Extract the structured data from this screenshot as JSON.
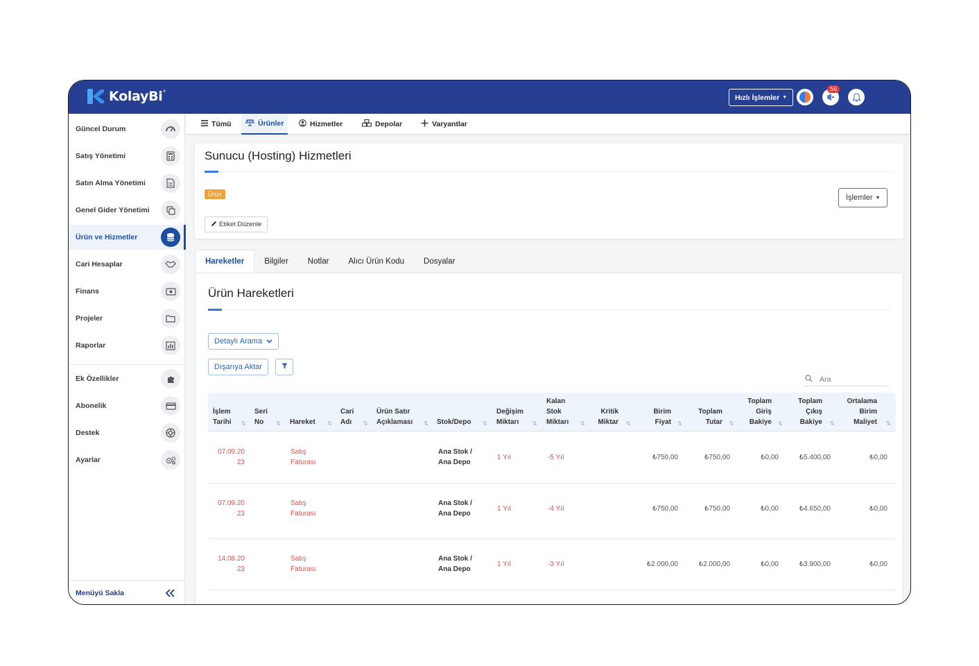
{
  "app": {
    "logo_text": "KolayBi",
    "logo_mark": "°",
    "quick_actions_label": "Hızlı İşlemler",
    "notification_count": "56",
    "colors": {
      "header": "#263f92",
      "accent": "#1d4f9c",
      "tag": "#f0a23b",
      "danger": "#d9534f"
    }
  },
  "sidebar": {
    "items": [
      {
        "label": "Güncel Durum",
        "icon": "dashboard-icon"
      },
      {
        "label": "Satış Yönetimi",
        "icon": "calculator-icon"
      },
      {
        "label": "Satın Alma Yönetimi",
        "icon": "document-icon"
      },
      {
        "label": "Genel Gider Yönetimi",
        "icon": "copy-icon"
      },
      {
        "label": "Ürün ve Hizmetler",
        "icon": "database-icon",
        "active": true
      },
      {
        "label": "Cari Hesaplar",
        "icon": "handshake-icon"
      },
      {
        "label": "Finans",
        "icon": "money-icon"
      },
      {
        "label": "Projeler",
        "icon": "folder-icon"
      },
      {
        "label": "Raporlar",
        "icon": "bar-chart-icon"
      },
      {
        "label": "Ek Özellikler",
        "icon": "puzzle-icon"
      },
      {
        "label": "Abonelik",
        "icon": "credit-card-icon"
      },
      {
        "label": "Destek",
        "icon": "lifebuoy-icon"
      },
      {
        "label": "Ayarlar",
        "icon": "gears-icon"
      }
    ],
    "hide_menu_label": "Menüyü Sakla"
  },
  "top_tabs": [
    {
      "label": "Tümü",
      "icon": "list-icon"
    },
    {
      "label": "Ürünler",
      "icon": "scale-icon",
      "active": true
    },
    {
      "label": "Hizmetler",
      "icon": "user-circle-icon"
    },
    {
      "label": "Depolar",
      "icon": "boxes-icon"
    },
    {
      "label": "Varyantlar",
      "icon": "plus-icon"
    }
  ],
  "product": {
    "title": "Sunucu (Hosting) Hizmetleri",
    "tag": "Ürün",
    "edit_tag_label": "Etiket Düzenle",
    "actions_label": "İşlemler"
  },
  "page_tabs": [
    {
      "label": "Hareketler",
      "active": true
    },
    {
      "label": "Bilgiler"
    },
    {
      "label": "Notlar"
    },
    {
      "label": "Alıcı Ürün Kodu"
    },
    {
      "label": "Dosyalar"
    }
  ],
  "movements": {
    "title": "Ürün Hareketleri",
    "detailed_search_label": "Detaylı Arama",
    "export_label": "Dışarıya Aktar",
    "search_placeholder": "Ara",
    "columns": [
      {
        "l1": "İşlem",
        "l2": "Tarihi"
      },
      {
        "l1": "Seri",
        "l2": "No"
      },
      {
        "l1": "",
        "l2": "Hareket"
      },
      {
        "l1": "Cari",
        "l2": "Adı"
      },
      {
        "l1": "Ürün Satır",
        "l2": "Açıklaması"
      },
      {
        "l1": "",
        "l2": "Stok/Depo"
      },
      {
        "l1": "Değişim",
        "l2": "Miktarı"
      },
      {
        "l0": "Kalan",
        "l1": "Stok",
        "l2": "Miktarı"
      },
      {
        "l1": "Kritik",
        "l2": "Miktar"
      },
      {
        "l1": "Birim",
        "l2": "Fiyat"
      },
      {
        "l1": "Toplam",
        "l2": "Tutar"
      },
      {
        "l0": "Toplam",
        "l1": "Giriş",
        "l2": "Bakiye"
      },
      {
        "l0": "Toplam",
        "l1": "Çıkış",
        "l2": "Bakiye"
      },
      {
        "l0": "Ortalama",
        "l1": "Birim",
        "l2": "Maliyet"
      }
    ],
    "rows": [
      {
        "date1": "07.09.20",
        "date2": "23",
        "move1": "Satış",
        "move2": "Faturası",
        "stock1": "Ana Stok /",
        "stock2": "Ana Depo",
        "change": "1 Yıl",
        "remaining": "-5 Yıl",
        "unit_price": "₺750,00",
        "total": "₺750,00",
        "in_balance": "₺0,00",
        "out_balance": "₺5.400,00",
        "avg_cost": "₺0,00"
      },
      {
        "date1": "07.09.20",
        "date2": "23",
        "move1": "Satış",
        "move2": "Faturası",
        "stock1": "Ana Stok /",
        "stock2": "Ana Depo",
        "change": "1 Yıl",
        "remaining": "-4 Yıl",
        "unit_price": "₺750,00",
        "total": "₺750,00",
        "in_balance": "₺0,00",
        "out_balance": "₺4.650,00",
        "avg_cost": "₺0,00"
      },
      {
        "date1": "14.08.20",
        "date2": "23",
        "move1": "Satış",
        "move2": "Faturası",
        "stock1": "Ana Stok /",
        "stock2": "Ana Depo",
        "change": "1 Yıl",
        "remaining": "-3 Yıl",
        "unit_price": "₺2.000,00",
        "total": "₺2.000,00",
        "in_balance": "₺0,00",
        "out_balance": "₺3.900,00",
        "avg_cost": "₺0,00"
      }
    ]
  }
}
